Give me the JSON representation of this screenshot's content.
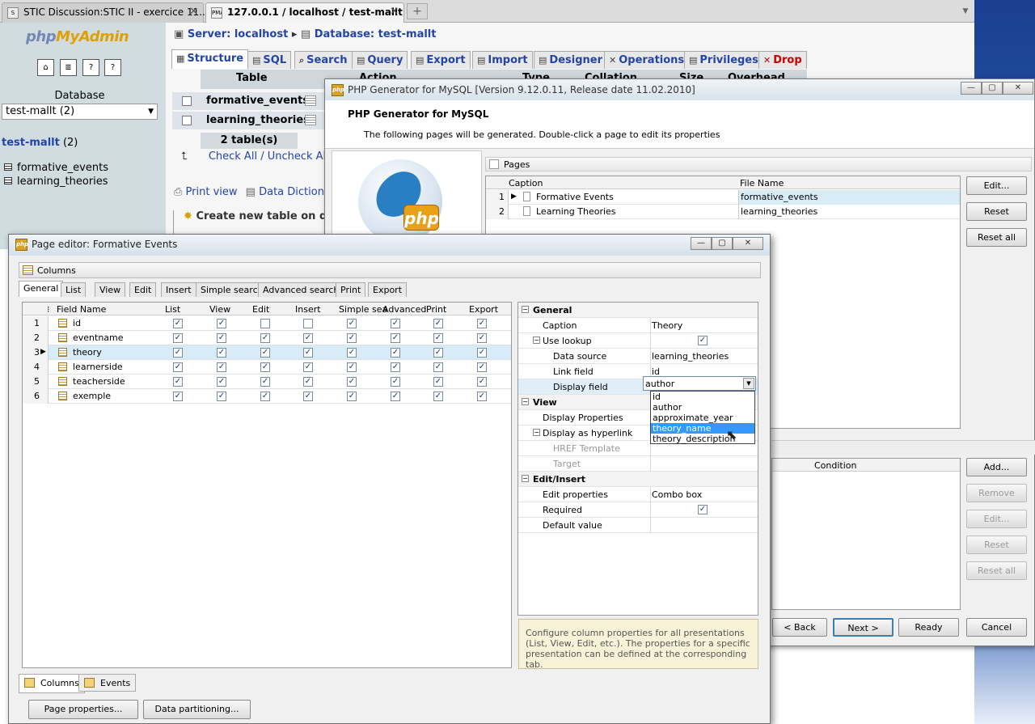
{
  "browser": {
    "tabs": [
      {
        "title": "STIC Discussion:STIC II - exercice 11...",
        "favicon": "S"
      },
      {
        "title": "127.0.0.1 / localhost / test-mallt | ...",
        "favicon": "PMA"
      }
    ],
    "new_tab": "+"
  },
  "pma": {
    "logo_a": "php",
    "logo_b": "MyAdmin",
    "icons": [
      "home-icon",
      "sql-icon",
      "docs-icon",
      "query-icon"
    ],
    "database_label": "Database",
    "database_selected": "test-mallt (2)",
    "db_link": "test-mallt",
    "db_count": "(2)",
    "tables": [
      "formative_events",
      "learning_theories"
    ],
    "breadcrumb_server": "Server: localhost",
    "breadcrumb_db": "Database: test-mallt",
    "tabs": [
      "Structure",
      "SQL",
      "Search",
      "Query",
      "Export",
      "Import",
      "Designer",
      "Operations",
      "Privileges",
      "Drop"
    ],
    "table_headers": [
      "Table",
      "Action",
      "Type",
      "Collation",
      "Size",
      "Overhead"
    ],
    "table_count": "2 table(s)",
    "check_all": "Check All",
    "uncheck_all": "Uncheck All",
    "print_view": "Print view",
    "data_dictionary": "Data Dictionar",
    "create_table": "Create new table on datab",
    "tab_icons": [
      "structure-icon",
      "sql-icon",
      "search-icon",
      "query-icon",
      "export-icon",
      "import-icon",
      "designer-icon",
      "operations-icon",
      "privileges-icon",
      "drop-icon"
    ]
  },
  "generator": {
    "title": "PHP Generator for MySQL [Version 9.12.0.11, Release date 11.02.2010]",
    "header_title": "PHP Generator for MySQL",
    "header_sub": "The following pages will be generated. Double-click a page to edit its properties",
    "logo_text": "php",
    "pages_label": "Pages",
    "cols": [
      "Caption",
      "File Name"
    ],
    "pages": [
      {
        "n": "1",
        "caption": "Formative Events",
        "file": "formative_events"
      },
      {
        "n": "2",
        "caption": "Learning Theories",
        "file": "learning_theories"
      }
    ],
    "buttons": [
      "Edit...",
      "Reset",
      "Reset all"
    ],
    "condition_label": "Condition",
    "cond_buttons": [
      "Add...",
      "Remove",
      "Edit...",
      "Reset",
      "Reset all"
    ],
    "nav_buttons": [
      "< Back",
      "Next >",
      "Ready",
      "Cancel"
    ]
  },
  "editor": {
    "title": "Page editor: Formative Events",
    "columns_label": "Columns",
    "tabs": [
      "General",
      "List",
      "View",
      "Edit",
      "Insert",
      "Simple search",
      "Advanced search",
      "Print",
      "Export"
    ],
    "grid_headers": [
      "Field Name",
      "List",
      "View",
      "Edit",
      "Insert",
      "Simple sea",
      "Advanced",
      "Print",
      "Export"
    ],
    "fields": [
      {
        "n": "1",
        "name": "id",
        "checks": [
          true,
          true,
          false,
          false,
          true,
          true,
          true,
          true
        ]
      },
      {
        "n": "2",
        "name": "eventname",
        "checks": [
          true,
          true,
          true,
          true,
          true,
          true,
          true,
          true
        ]
      },
      {
        "n": "3",
        "name": "theory",
        "checks": [
          true,
          true,
          true,
          true,
          true,
          true,
          true,
          true
        ]
      },
      {
        "n": "4",
        "name": "learnerside",
        "checks": [
          true,
          true,
          true,
          true,
          true,
          true,
          true,
          true
        ]
      },
      {
        "n": "5",
        "name": "teacherside",
        "checks": [
          true,
          true,
          true,
          true,
          true,
          true,
          true,
          true
        ]
      },
      {
        "n": "6",
        "name": "exemple",
        "checks": [
          true,
          true,
          true,
          true,
          true,
          true,
          true,
          true
        ]
      }
    ],
    "props": {
      "general": "General",
      "caption_label": "Caption",
      "caption_value": "Theory",
      "use_lookup": "Use lookup",
      "data_source_label": "Data source",
      "data_source_value": "learning_theories",
      "link_field_label": "Link field",
      "link_field_value": "id",
      "display_field_label": "Display field",
      "display_field_value": "author",
      "view": "View",
      "display_properties": "Display Properties",
      "display_hyperlink": "Display as hyperlink",
      "href_template": "HREF Template",
      "target": "Target",
      "edit_insert": "Edit/Insert",
      "edit_properties_label": "Edit properties",
      "edit_properties_value": "Combo box",
      "required": "Required",
      "default_value": "Default value"
    },
    "dropdown_options": [
      "id",
      "author",
      "approximate_year",
      "theory_name",
      "theory_description"
    ],
    "dropdown_selected": "theory_name",
    "hint": "Configure column properties for all presentations (List, View, Edit, etc.). The properties for a specific presentation can be defined at the corresponding tab.",
    "bottom_tabs": [
      "Columns",
      "Events"
    ],
    "page_properties": "Page properties...",
    "data_partitioning": "Data partitioning..."
  }
}
